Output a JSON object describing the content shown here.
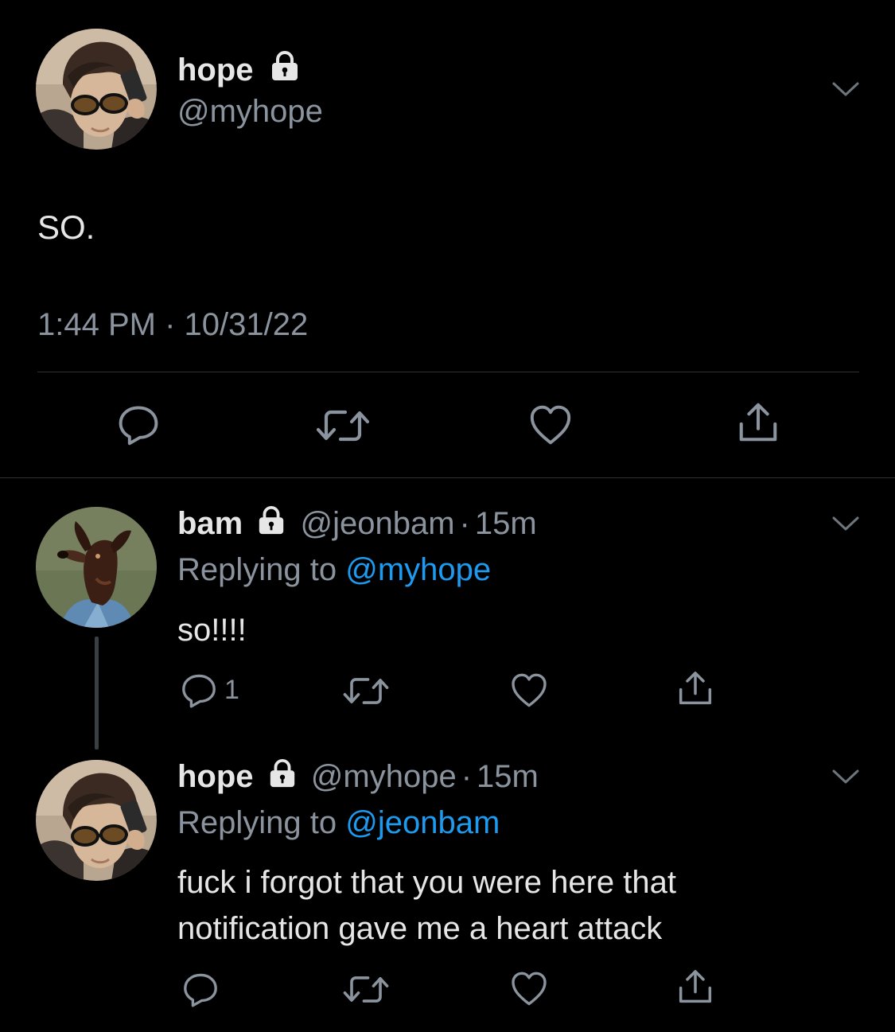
{
  "main_tweet": {
    "name": "hope",
    "handle": "@myhope",
    "text": "SO.",
    "time": "1:44 PM",
    "separator": "·",
    "date": "10/31/22"
  },
  "replies": [
    {
      "name": "bam",
      "handle": "@jeonbam",
      "separator": "·",
      "age": "15m",
      "replying_prefix": "Replying to",
      "replying_to": "@myhope",
      "text": "so!!!!",
      "reply_count": "1"
    },
    {
      "name": "hope",
      "handle": "@myhope",
      "separator": "·",
      "age": "15m",
      "replying_prefix": "Replying to",
      "replying_to": "@jeonbam",
      "text_line1": "fuck i forgot that you were here that",
      "text_line2": "notification gave me a heart attack"
    }
  ],
  "icons": {
    "protected": "lock-icon",
    "menu": "chevron-down-icon",
    "reply": "reply-icon",
    "retweet": "retweet-icon",
    "like": "heart-icon",
    "share": "share-icon"
  },
  "colors": {
    "background": "#000000",
    "text": "#e6e6e6",
    "muted": "#8b949e",
    "link": "#1d9bf0",
    "divider": "#2f3336"
  }
}
